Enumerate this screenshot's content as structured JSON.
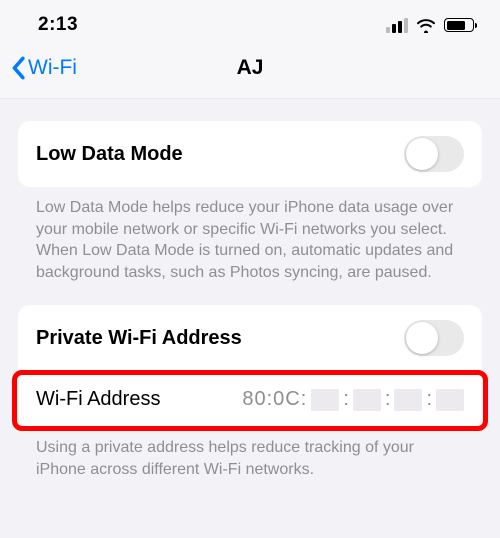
{
  "status": {
    "time": "2:13"
  },
  "nav": {
    "back_label": "Wi-Fi",
    "title": "AJ"
  },
  "group1": {
    "row": {
      "label": "Low Data Mode",
      "toggle_on": false
    },
    "footer": "Low Data Mode helps reduce your iPhone data usage over your mobile network or specific Wi-Fi networks you select. When Low Data Mode is turned on, automatic updates and background tasks, such as Photos syncing, are paused."
  },
  "group2": {
    "row1": {
      "label": "Private Wi-Fi Address",
      "toggle_on": false
    },
    "row2": {
      "label": "Wi-Fi Address",
      "value_prefix": "80:0C:",
      "sep": ":"
    },
    "footer": "Using a private address helps reduce tracking of your iPhone across different Wi-Fi networks."
  }
}
